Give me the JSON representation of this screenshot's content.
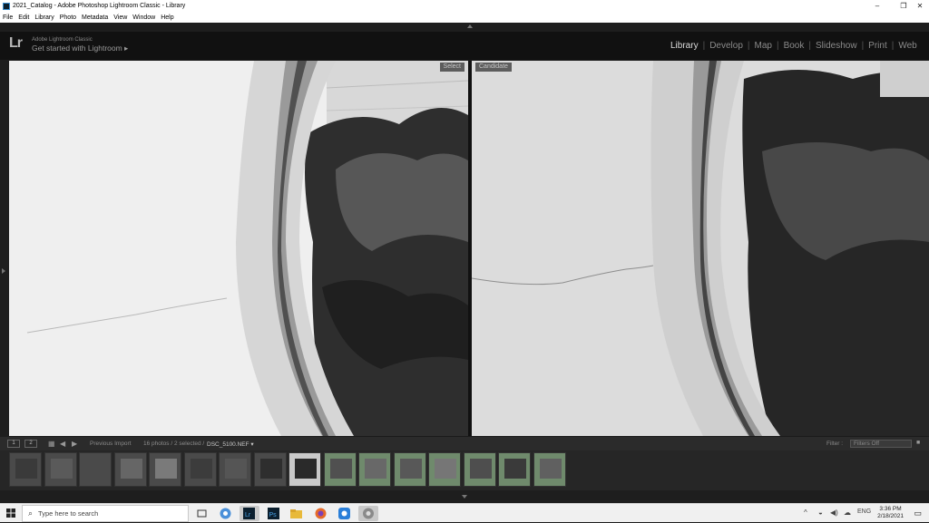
{
  "window": {
    "title": "2021_Catalog - Adobe Photoshop Lightroom Classic - Library",
    "minimize_label": "–",
    "restore_label": "❐",
    "close_label": "✕"
  },
  "menu": [
    "File",
    "Edit",
    "Library",
    "Photo",
    "Metadata",
    "View",
    "Window",
    "Help"
  ],
  "identity_plate": {
    "logo": "Lr",
    "brand": "Adobe Lightroom Classic",
    "tagline": "Get started with Lightroom ▸"
  },
  "modules": [
    "Library",
    "Develop",
    "Map",
    "Book",
    "Slideshow",
    "Print",
    "Web"
  ],
  "active_module": "Library",
  "compare": {
    "select_label": "Select",
    "candidate_label": "Candidate"
  },
  "filmstrip_bar": {
    "page1": "1",
    "page2": "2",
    "source": "Previous Import",
    "info": "16 photos / 2 selected /",
    "filename": "DSC_5100.NEF ▾",
    "filter_label": "Filter :",
    "filter_value": "Filters Off"
  },
  "thumbnails": [
    {
      "state": "normal"
    },
    {
      "state": "normal"
    },
    {
      "state": "normal"
    },
    {
      "state": "normal"
    },
    {
      "state": "normal"
    },
    {
      "state": "normal"
    },
    {
      "state": "normal"
    },
    {
      "state": "normal"
    },
    {
      "state": "active"
    },
    {
      "state": "selected"
    },
    {
      "state": "selected"
    },
    {
      "state": "selected"
    },
    {
      "state": "selected"
    },
    {
      "state": "selected"
    },
    {
      "state": "selected"
    },
    {
      "state": "selected"
    }
  ],
  "taskbar": {
    "search_placeholder": "Type here to search",
    "language": "ENG",
    "time": "3:36 PM",
    "date": "2/18/2021"
  },
  "colors": {
    "selected_thumb": "#6f8a6c",
    "active_thumb": "#c9c9c9"
  }
}
